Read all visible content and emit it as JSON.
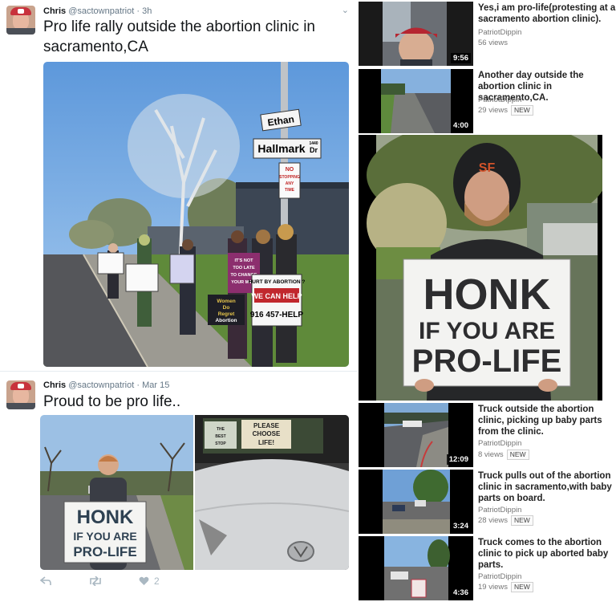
{
  "tweets": [
    {
      "name": "Chris",
      "handle": "@sactownpatriot",
      "separator": "·",
      "time": "3h",
      "text": "Pro life rally outside the abortion clinic in sacramento,CA",
      "photo_signs": {
        "street1": "Ethan",
        "street2": "Hallmark",
        "street2_suffix": "Dr",
        "street2_number": "1440",
        "no_stopping": [
          "NO",
          "STOPPING",
          "ANY",
          "TIME"
        ],
        "sign_a": [
          "IT'S NOT",
          "TOO LATE",
          "TO CHANGE",
          "YOUR MIND"
        ],
        "sign_b": [
          "HURT BY ABORTION ?",
          "WE CAN HELP",
          "916 457-HELP"
        ],
        "sign_c": [
          "Women",
          "Do",
          "Regret",
          "Abortion"
        ]
      }
    },
    {
      "name": "Chris",
      "handle": "@sactownpatriot",
      "separator": "·",
      "time": "Mar 15",
      "text": "Proud to be pro life..",
      "sign_lines": [
        "HONK",
        "IF YOU ARE",
        "PRO-LIFE"
      ],
      "car_sign": [
        "PLEASE",
        "CHOOSE",
        "LIFE!"
      ],
      "car_badge": [
        "THE",
        "BEST",
        "STOP"
      ],
      "likes": "2",
      "actions": {
        "reply_icon": "reply-icon",
        "retweet_icon": "retweet-icon",
        "like_icon": "heart-icon"
      }
    }
  ],
  "videos": [
    {
      "title": "Yes,i am pro-life(protesting at a sacramento abortion clinic).",
      "channel": "PatriotDippin",
      "views": "56 views",
      "duration": "9:56",
      "badge": ""
    },
    {
      "title": "Another day outside the abortion clinic in sacramento,CA.",
      "channel": "PatriotDippin",
      "views": "29 views",
      "duration": "4:00",
      "badge": "NEW"
    },
    {
      "title": "Truck outside the abortion clinic, picking up baby parts from the clinic.",
      "channel": "PatriotDippin",
      "views": "8 views",
      "duration": "12:09",
      "badge": "NEW"
    },
    {
      "title": "Truck pulls out of the abortion clinic in sacramento,with baby parts on board.",
      "channel": "PatriotDippin",
      "views": "28 views",
      "duration": "3:24",
      "badge": "NEW"
    },
    {
      "title": "Truck comes to the abortion clinic to pick up aborted baby parts.",
      "channel": "PatriotDippin",
      "views": "19 views",
      "duration": "4:36",
      "badge": "NEW"
    }
  ],
  "big_video": {
    "sign_lines": [
      "HONK",
      "IF YOU ARE",
      "PRO-LIFE"
    ],
    "cap_logo": "SF"
  },
  "colors": {
    "twitter_text": "#14171a",
    "twitter_meta": "#657786",
    "icon_grey": "#aab8c2",
    "sky": "#7fb2e5"
  }
}
